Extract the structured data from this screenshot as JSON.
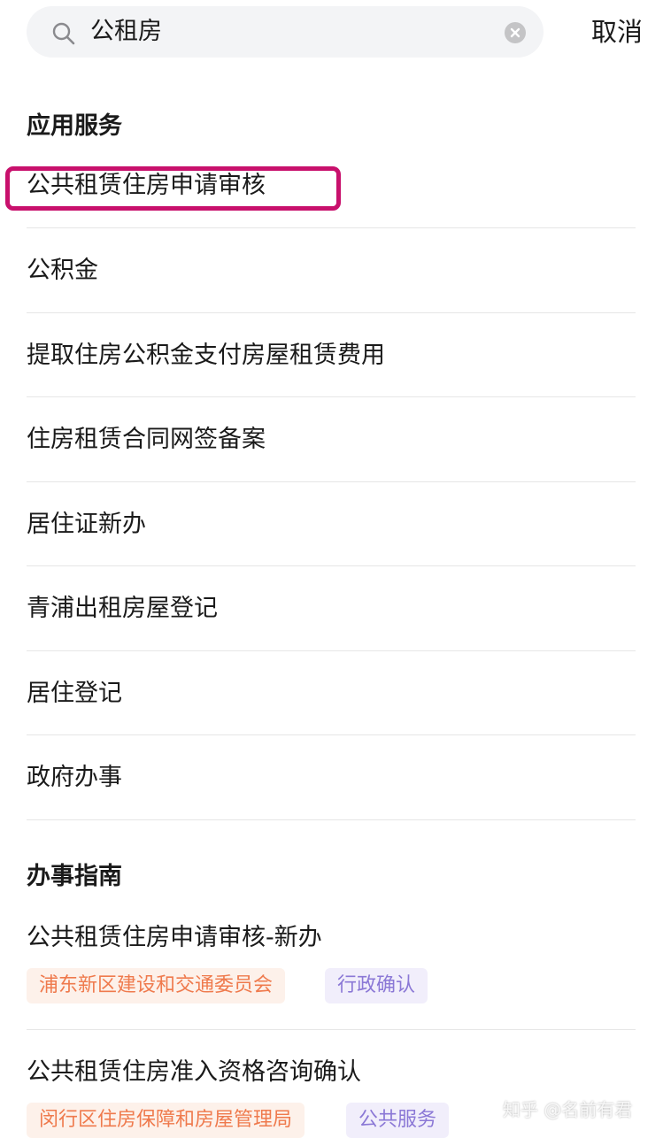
{
  "search": {
    "query": "公租房",
    "cancel_label": "取消"
  },
  "apps_section": {
    "title": "应用服务",
    "items": [
      {
        "label": "公共租赁住房申请审核"
      },
      {
        "label": "公积金"
      },
      {
        "label": "提取住房公积金支付房屋租赁费用"
      },
      {
        "label": "住房租赁合同网签备案"
      },
      {
        "label": "居住证新办"
      },
      {
        "label": "青浦出租房屋登记"
      },
      {
        "label": "居住登记"
      },
      {
        "label": "政府办事"
      }
    ]
  },
  "guides_section": {
    "title": "办事指南",
    "items": [
      {
        "title": "公共租赁住房申请审核-新办",
        "tags": [
          "浦东新区建设和交通委员会",
          "行政确认"
        ]
      },
      {
        "title": "公共租赁住房准入资格咨询确认",
        "tags": [
          "闵行区住房保障和房屋管理局",
          "公共服务"
        ]
      }
    ]
  },
  "highlight_color": "#c8106c",
  "watermark": "知乎 @名前有君"
}
